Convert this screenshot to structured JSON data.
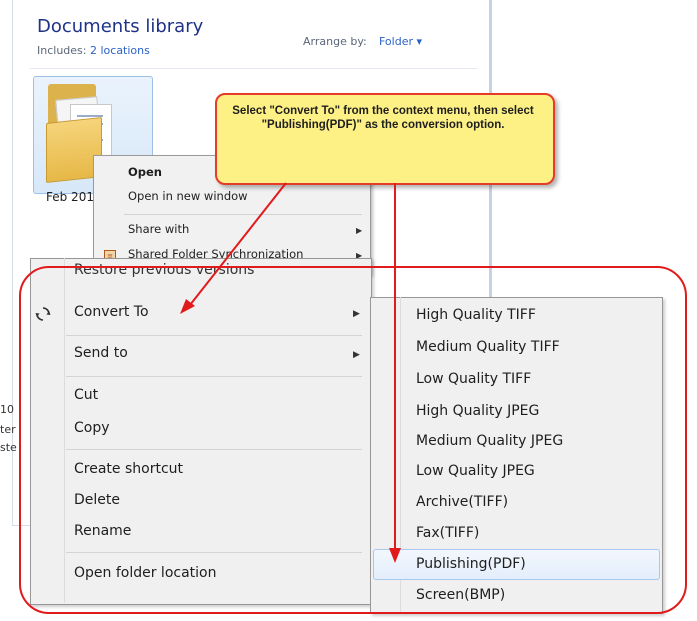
{
  "explorer": {
    "title": "Documents library",
    "includes_prefix": "Includes:",
    "includes_link": "2 locations",
    "arrange_label": "Arrange by:",
    "arrange_value": "Folder ▾",
    "folder_label": "Feb 2010",
    "left_edge_fragments": [
      "10",
      "ter",
      "ste"
    ]
  },
  "small_menu": {
    "items": [
      "Open",
      "Open in new window",
      "Share with",
      "Shared Folder Synchronization",
      "Restore previous versions"
    ]
  },
  "context_menu": {
    "convert_to": "Convert To",
    "send_to": "Send to",
    "cut": "Cut",
    "copy": "Copy",
    "create_shortcut": "Create shortcut",
    "delete": "Delete",
    "rename": "Rename",
    "open_folder_location": "Open folder location",
    "submenu_arrow": "▶"
  },
  "submenu": {
    "items": [
      "High Quality TIFF",
      "Medium Quality TIFF",
      "Low Quality TIFF",
      "High Quality JPEG",
      "Medium Quality JPEG",
      "Low Quality JPEG",
      "Archive(TIFF)",
      "Fax(TIFF)",
      "Publishing(PDF)",
      "Screen(BMP)"
    ],
    "selected": "Publishing(PDF)"
  },
  "callout": {
    "text": "Select \"Convert To\" from the context menu, then select \"Publishing(PDF)\" as the conversion option."
  },
  "colors": {
    "annotation_red": "#e11b1b",
    "callout_yellow": "#fdf085",
    "link_blue": "#2a62c9",
    "title_blue": "#1e3287"
  },
  "icons": [
    "folder-icon",
    "convert-to-icon",
    "shared-folder-sync-icon",
    "submenu-arrow-icon"
  ]
}
